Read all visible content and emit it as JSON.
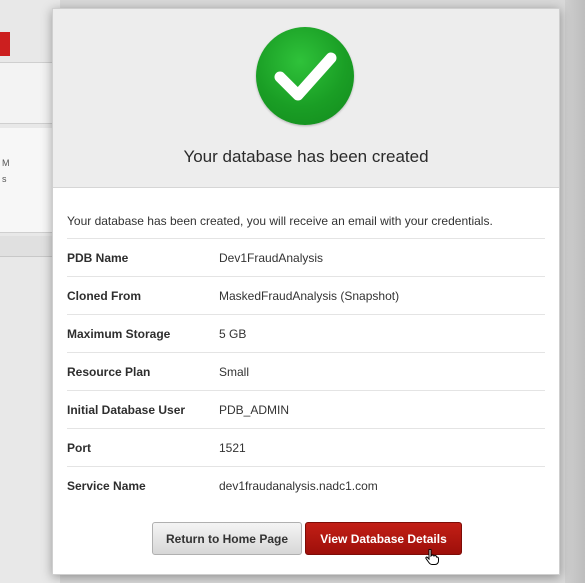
{
  "background": {
    "fragment_texts": [
      "M",
      "s"
    ]
  },
  "dialog": {
    "icon": "checkmark-icon",
    "title": "Your database has been created",
    "message": "Your database has been created, you will receive an email with your credentials.",
    "details": [
      {
        "label": "PDB Name",
        "value": "Dev1FraudAnalysis"
      },
      {
        "label": "Cloned From",
        "value": "MaskedFraudAnalysis (Snapshot)"
      },
      {
        "label": "Maximum Storage",
        "value": "5 GB"
      },
      {
        "label": "Resource Plan",
        "value": "Small"
      },
      {
        "label": "Initial Database User",
        "value": "PDB_ADMIN"
      },
      {
        "label": "Port",
        "value": "1521"
      },
      {
        "label": "Service Name",
        "value": "dev1fraudanalysis.nadc1.com"
      }
    ],
    "buttons": {
      "home_label": "Return to Home Page",
      "details_label": "View Database Details"
    }
  },
  "colors": {
    "success_green": "#1a9e25",
    "primary_button": "#b0150e",
    "header_bg": "#ededed"
  }
}
